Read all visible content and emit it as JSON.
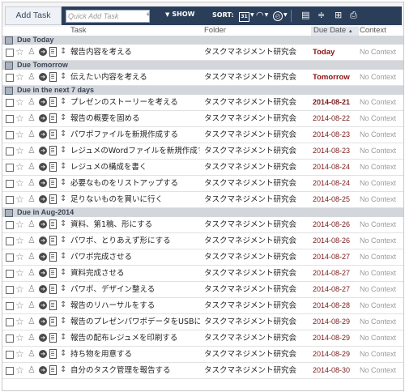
{
  "toolbar": {
    "add_task_label": "Add Task",
    "quick_add_placeholder": "Quick Add Task",
    "show_label": "SHOW",
    "sort_label": "SORT:",
    "calendar_label": "31",
    "icons": [
      "calendar-icon",
      "priority-icon",
      "clock-icon",
      "list-view-icon",
      "split-view-icon",
      "print-icon"
    ]
  },
  "columns": {
    "task": "Task",
    "folder": "Folder",
    "due_date": "Due Date",
    "context": "Context"
  },
  "groups": [
    {
      "label": "Due Today",
      "tasks": [
        {
          "title": "報告内容を考える",
          "folder": "タスクマネジメント研究会",
          "due": "Today",
          "context": "No Context"
        }
      ]
    },
    {
      "label": "Due Tomorrow",
      "tasks": [
        {
          "title": "伝えたい内容を考える",
          "folder": "タスクマネジメント研究会",
          "due": "Tomorrow",
          "context": "No Context"
        }
      ]
    },
    {
      "label": "Due in the next 7 days",
      "tasks": [
        {
          "title": "プレゼンのストーリーを考える",
          "folder": "タスクマネジメント研究会",
          "due": "2014-08-21",
          "context": "No Context"
        },
        {
          "title": "報告の概要を固める",
          "folder": "タスクマネジメント研究会",
          "due": "2014-08-22",
          "context": "No Context"
        },
        {
          "title": "パワポファイルを新規作成する",
          "folder": "タスクマネジメント研究会",
          "due": "2014-08-23",
          "context": "No Context"
        },
        {
          "title": "レジュメのWordファイルを新規作成する",
          "folder": "タスクマネジメント研究会",
          "due": "2014-08-23",
          "context": "No Context"
        },
        {
          "title": "レジュメの構成を書く",
          "folder": "タスクマネジメント研究会",
          "due": "2014-08-24",
          "context": "No Context"
        },
        {
          "title": "必要なものをリストアップする",
          "folder": "タスクマネジメント研究会",
          "due": "2014-08-24",
          "context": "No Context"
        },
        {
          "title": "足りないものを買いに行く",
          "folder": "タスクマネジメント研究会",
          "due": "2014-08-25",
          "context": "No Context"
        }
      ]
    },
    {
      "label": "Due in Aug-2014",
      "tasks": [
        {
          "title": "資料、第1稿、形にする",
          "folder": "タスクマネジメント研究会",
          "due": "2014-08-26",
          "context": "No Context"
        },
        {
          "title": "パワポ、とりあえず形にする",
          "folder": "タスクマネジメント研究会",
          "due": "2014-08-26",
          "context": "No Context"
        },
        {
          "title": "パワポ完成させる",
          "folder": "タスクマネジメント研究会",
          "due": "2014-08-27",
          "context": "No Context"
        },
        {
          "title": "資料完成させる",
          "folder": "タスクマネジメント研究会",
          "due": "2014-08-27",
          "context": "No Context"
        },
        {
          "title": "パワポ、デザイン整える",
          "folder": "タスクマネジメント研究会",
          "due": "2014-08-27",
          "context": "No Context"
        },
        {
          "title": "報告のリハーサルをする",
          "folder": "タスクマネジメント研究会",
          "due": "2014-08-28",
          "context": "No Context"
        },
        {
          "title": "報告のプレゼンパワポデータをUSBに…",
          "folder": "タスクマネジメント研究会",
          "due": "2014-08-29",
          "context": "No Context"
        },
        {
          "title": "報告の配布レジュメを印刷する",
          "folder": "タスクマネジメント研究会",
          "due": "2014-08-29",
          "context": "No Context"
        },
        {
          "title": "持ち物を用意する",
          "folder": "タスクマネジメント研究会",
          "due": "2014-08-29",
          "context": "No Context"
        },
        {
          "title": "自分のタスク管理を報告する",
          "folder": "タスクマネジメント研究会",
          "due": "2014-08-30",
          "context": "No Context"
        }
      ]
    }
  ]
}
